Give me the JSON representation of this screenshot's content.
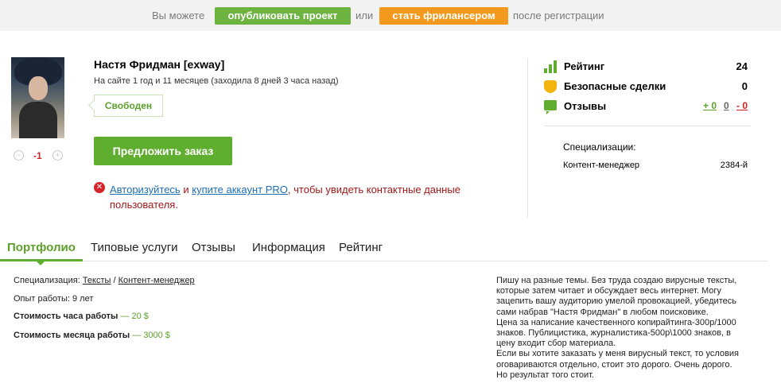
{
  "topbar": {
    "prefix": "Вы можете",
    "publish_button": "опубликовать проект",
    "or": "или",
    "freelancer_button": "стать фрилансером",
    "suffix": "после регистрации"
  },
  "profile": {
    "name": "Настя Фридман [exway]",
    "since": "На сайте 1 год и 11 месяцев (заходила 8 дней 3 часа назад)",
    "status": "Свободен",
    "offer_button": "Предложить заказ",
    "vote_score": "-1",
    "auth": {
      "login_link": "Авторизуйтесь",
      "and": "и",
      "buy_pro_link": "купите аккаунт PRO",
      "rest": ", чтобы увидеть контактные данные пользователя."
    }
  },
  "stats": {
    "rating_label": "Рейтинг",
    "rating_value": "24",
    "safe_deals_label": "Безопасные сделки",
    "safe_deals_value": "0",
    "reviews_label": "Отзывы",
    "reviews_positive": "+ 0",
    "reviews_neutral": "0",
    "reviews_negative": "- 0",
    "specializations_heading": "Специализации:",
    "specialization": "Контент-менеджер",
    "specialization_rank": "2384-й"
  },
  "tabs": [
    "Портфолио",
    "Типовые услуги",
    "Отзывы",
    "Информация",
    "Рейтинг"
  ],
  "details": {
    "specialization_label": "Специализация:",
    "spec_link_1": "Тексты",
    "spec_sep": "/",
    "spec_link_2": "Контент-менеджер",
    "experience_label": "Опыт работы:",
    "experience_value": "9 лет",
    "hour_cost_label": "Стоимость часа работы",
    "hour_cost_value": "— 20 $",
    "month_cost_label": "Стоимость месяца работы",
    "month_cost_value": "— 3000 $"
  },
  "description": [
    "Пишу на разные темы. Без труда создаю вирусные тексты,",
    "которые затем читает и обсуждает весь интернет. Могу",
    "зацепить вашу аудиторию умелой провокацией, убедитесь",
    "сами набрав \"Настя Фридман\" в любом поисковике.",
    "Цена за написание качественного копирайтинга-300р/1000",
    "знаков. Публицистика, журналистика-500р\\1000 знаков, в",
    "цену входит сбор материала.",
    "Если вы хотите заказать у меня вирусный текст, то условия",
    "оговариваются отдельно, стоит это дорого. Очень дорого.",
    "Но результат того стоит."
  ],
  "colors": {
    "accent_green": "#5fae30",
    "orange": "#f39a1e",
    "error_red": "#d4242a",
    "link_blue": "#1f6fb5"
  }
}
